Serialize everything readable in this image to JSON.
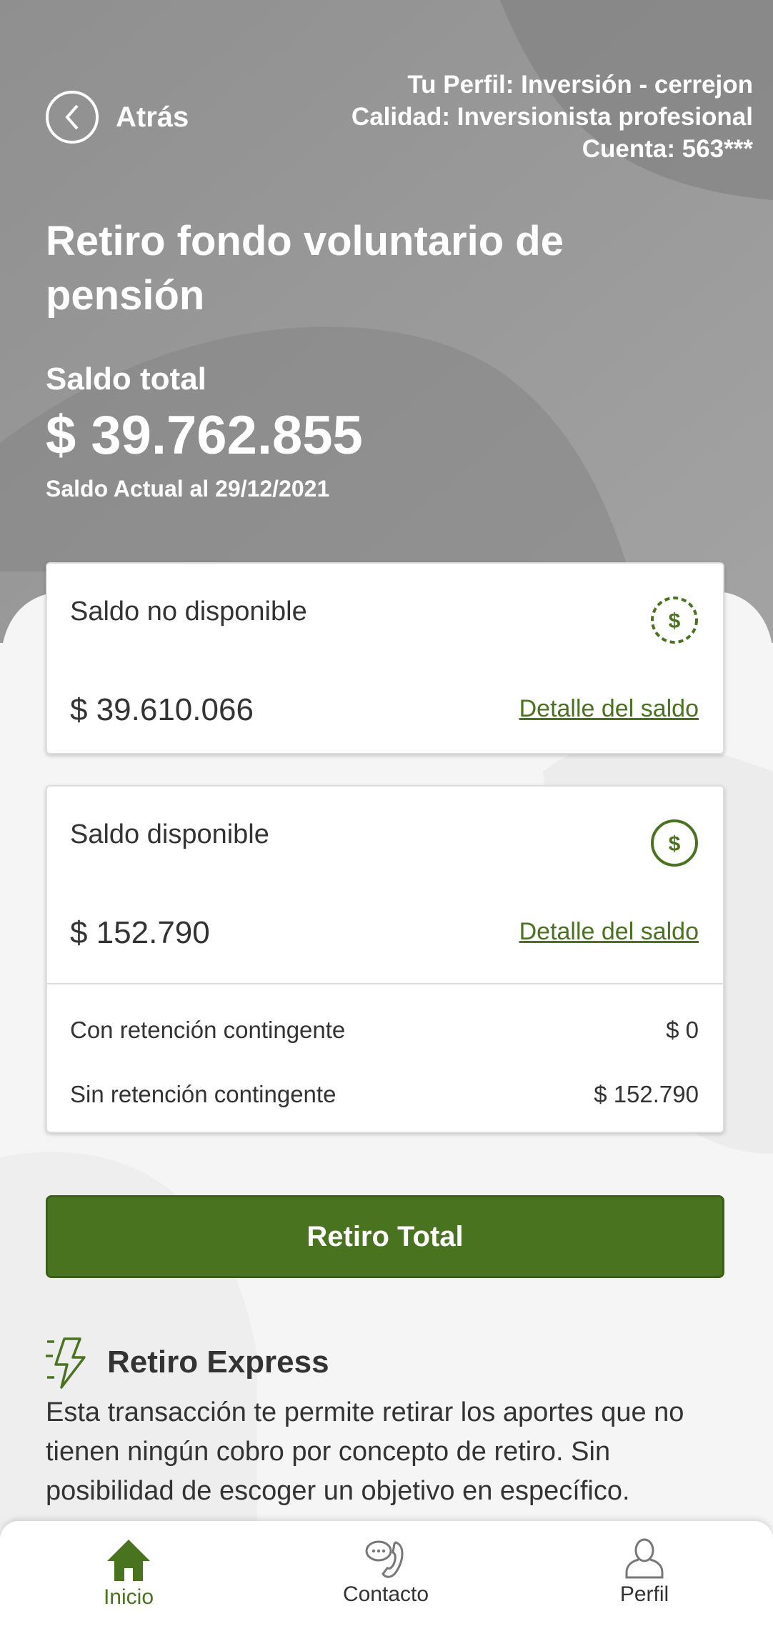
{
  "header": {
    "back_label": "Atrás",
    "profile_line": "Tu Perfil: Inversión - cerrejon",
    "quality_line": "Calidad: Inversionista profesional",
    "account_line": "Cuenta: 563***"
  },
  "page": {
    "title": "Retiro fondo voluntario de pensión",
    "total_label": "Saldo total",
    "total_amount": "$ 39.762.855",
    "total_date": "Saldo Actual al 29/12/2021"
  },
  "cards": {
    "unavailable": {
      "label": "Saldo no disponible",
      "amount": "$ 39.610.066",
      "link": "Detalle del saldo",
      "icon": "dollar-dashed-circle-icon"
    },
    "available": {
      "label": "Saldo disponible",
      "amount": "$ 152.790",
      "link": "Detalle del saldo",
      "icon": "dollar-circle-icon",
      "rows": [
        {
          "label": "Con retención contingente",
          "value": "$ 0"
        },
        {
          "label": "Sin retención contingente",
          "value": "$ 152.790"
        }
      ]
    }
  },
  "actions": {
    "total_withdrawal": "Retiro Total"
  },
  "express": {
    "title": "Retiro Express",
    "text": "Esta transacción te permite retirar los aportes que no tienen ningún cobro por concepto de retiro. Sin posibilidad de escoger un objetivo en específico."
  },
  "nav": {
    "items": [
      {
        "label": "Inicio",
        "icon": "home-icon",
        "active": true
      },
      {
        "label": "Contacto",
        "icon": "phone-chat-icon"
      },
      {
        "label": "Perfil",
        "icon": "user-icon"
      }
    ]
  },
  "colors": {
    "accent": "#4a7320",
    "header_bg": "#8c8c8c",
    "surface": "#f5f5f5"
  }
}
